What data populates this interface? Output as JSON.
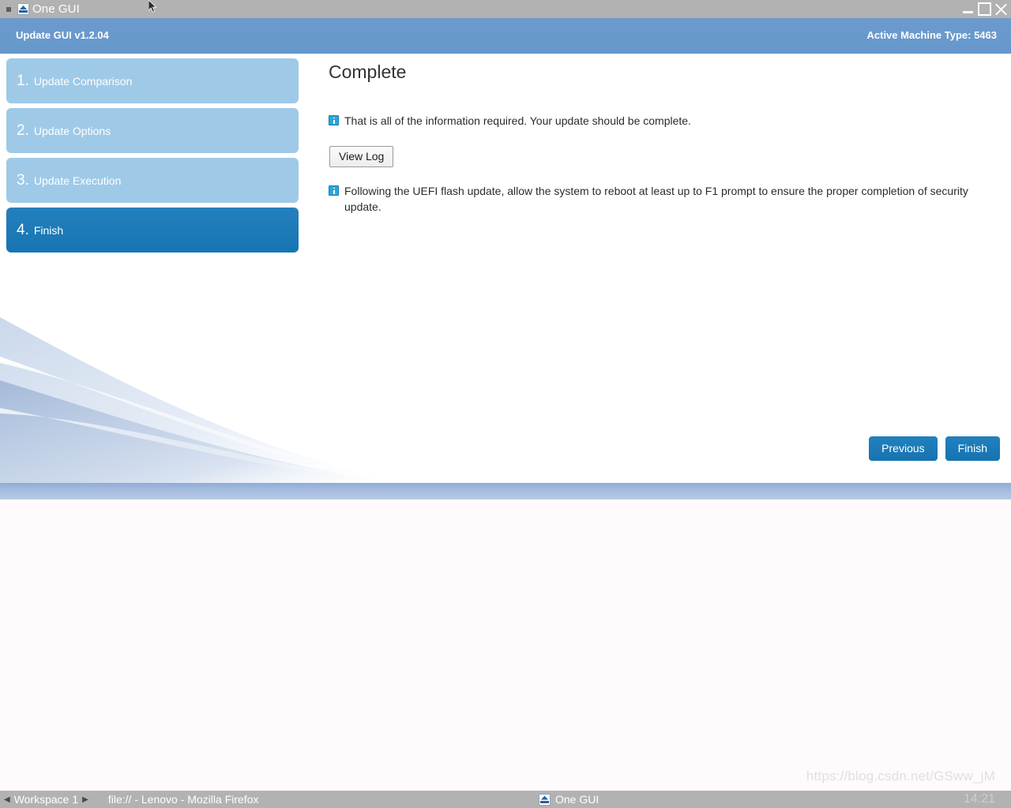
{
  "window": {
    "title": "One GUI",
    "icon": "app-icon",
    "controls": {
      "minimize": "minimize-icon",
      "maximize": "maximize-icon",
      "close": "close-icon"
    }
  },
  "header": {
    "left_label": "Update GUI v1.2.04",
    "right_label": "Active Machine Type: 5463"
  },
  "steps": [
    {
      "num": "1.",
      "label": "Update Comparison",
      "active": false
    },
    {
      "num": "2.",
      "label": "Update Options",
      "active": false
    },
    {
      "num": "3.",
      "label": "Update Execution",
      "active": false
    },
    {
      "num": "4.",
      "label": "Finish",
      "active": true
    }
  ],
  "content": {
    "title": "Complete",
    "message_1": "That is all of the information required. Your update should be complete.",
    "view_log_label": "View Log",
    "message_2": "Following the UEFI flash update, allow the system to reboot at least up to F1 prompt to ensure the proper completion of security update."
  },
  "nav": {
    "previous_label": "Previous",
    "finish_label": "Finish"
  },
  "taskbar": {
    "workspace": "Workspace 1",
    "window_1": "file:// - Lenovo - Mozilla Firefox",
    "window_2": "One GUI",
    "clock": "14:21",
    "prev_arrow": "◀",
    "next_arrow": "▶"
  },
  "desktop": {
    "watermark": "https://blog.csdn.net/GSww_jM"
  },
  "colors": {
    "titlebar": "#b2b2b2",
    "header_blue": "#6699cc",
    "step_inactive": "#9ecae8",
    "step_active": "#1a7ab8",
    "button_blue": "#1a7ab8",
    "info_icon": "#2ba5dd",
    "footer_strip": "#a6bcdf",
    "desktop_bg": "#fffafc"
  }
}
